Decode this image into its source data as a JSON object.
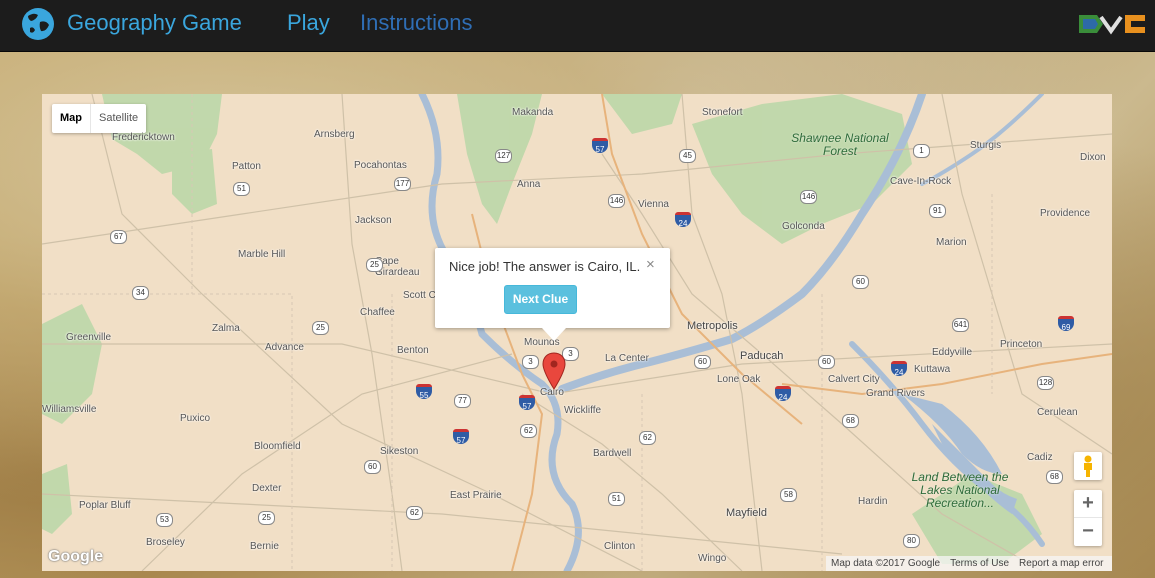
{
  "navbar": {
    "brand_title": "Geography Game",
    "play_label": "Play",
    "instructions_label": "Instructions",
    "title_color": "#3aa6dd",
    "instructions_color": "#2f6eb5"
  },
  "map": {
    "type_controls": {
      "map_label": "Map",
      "satellite_label": "Satellite",
      "selected": "Map"
    },
    "info_window": {
      "message": "Nice job! The answer is Cairo, IL.",
      "close_symbol": "×",
      "next_button_label": "Next Clue",
      "button_color": "#5bc0de"
    },
    "zoom": {
      "in_label": "+",
      "out_label": "−"
    },
    "logo_text": "Google",
    "attribution": {
      "data_text": "Map data ©2017 Google",
      "terms_label": "Terms of Use",
      "report_label": "Report a map error"
    },
    "places": [
      "Makanda",
      "Stonefort",
      "Fredericktown",
      "Arnsberg",
      "Patton",
      "Pocahontas",
      "Anna",
      "Vienna",
      "Sturgis",
      "Dixon",
      "Cave-In-Rock",
      "Providence",
      "Golconda",
      "Jackson",
      "Marble Hill",
      "Marion",
      "Cape Girardeau",
      "Scott City",
      "Chaffee",
      "Zalma",
      "Greenville",
      "Advance",
      "Benton",
      "Mounds",
      "Metropolis",
      "La Center",
      "Paducah",
      "Lone Oak",
      "Calvert City",
      "Eddyville",
      "Princeton",
      "Kuttawa",
      "Grand Rivers",
      "Cairo",
      "Wickliffe",
      "Puxico",
      "Bloomfield",
      "Sikeston",
      "Bardwell",
      "Cerulean",
      "Cadiz",
      "Dexter",
      "East Prairie",
      "Mayfield",
      "Hardin",
      "Poplar Bluff",
      "Broseley",
      "Bernie",
      "Clinton",
      "Wingo",
      "Williamsville"
    ],
    "parks": [
      "Shawnee National Forest",
      "Land Between the Lakes National Recreation..."
    ],
    "highways": [
      "67",
      "51",
      "177",
      "127",
      "45",
      "57",
      "1",
      "146",
      "24",
      "91",
      "25",
      "34",
      "3",
      "60",
      "641",
      "69",
      "55",
      "77",
      "62",
      "128",
      "68",
      "58",
      "53",
      "80"
    ]
  }
}
